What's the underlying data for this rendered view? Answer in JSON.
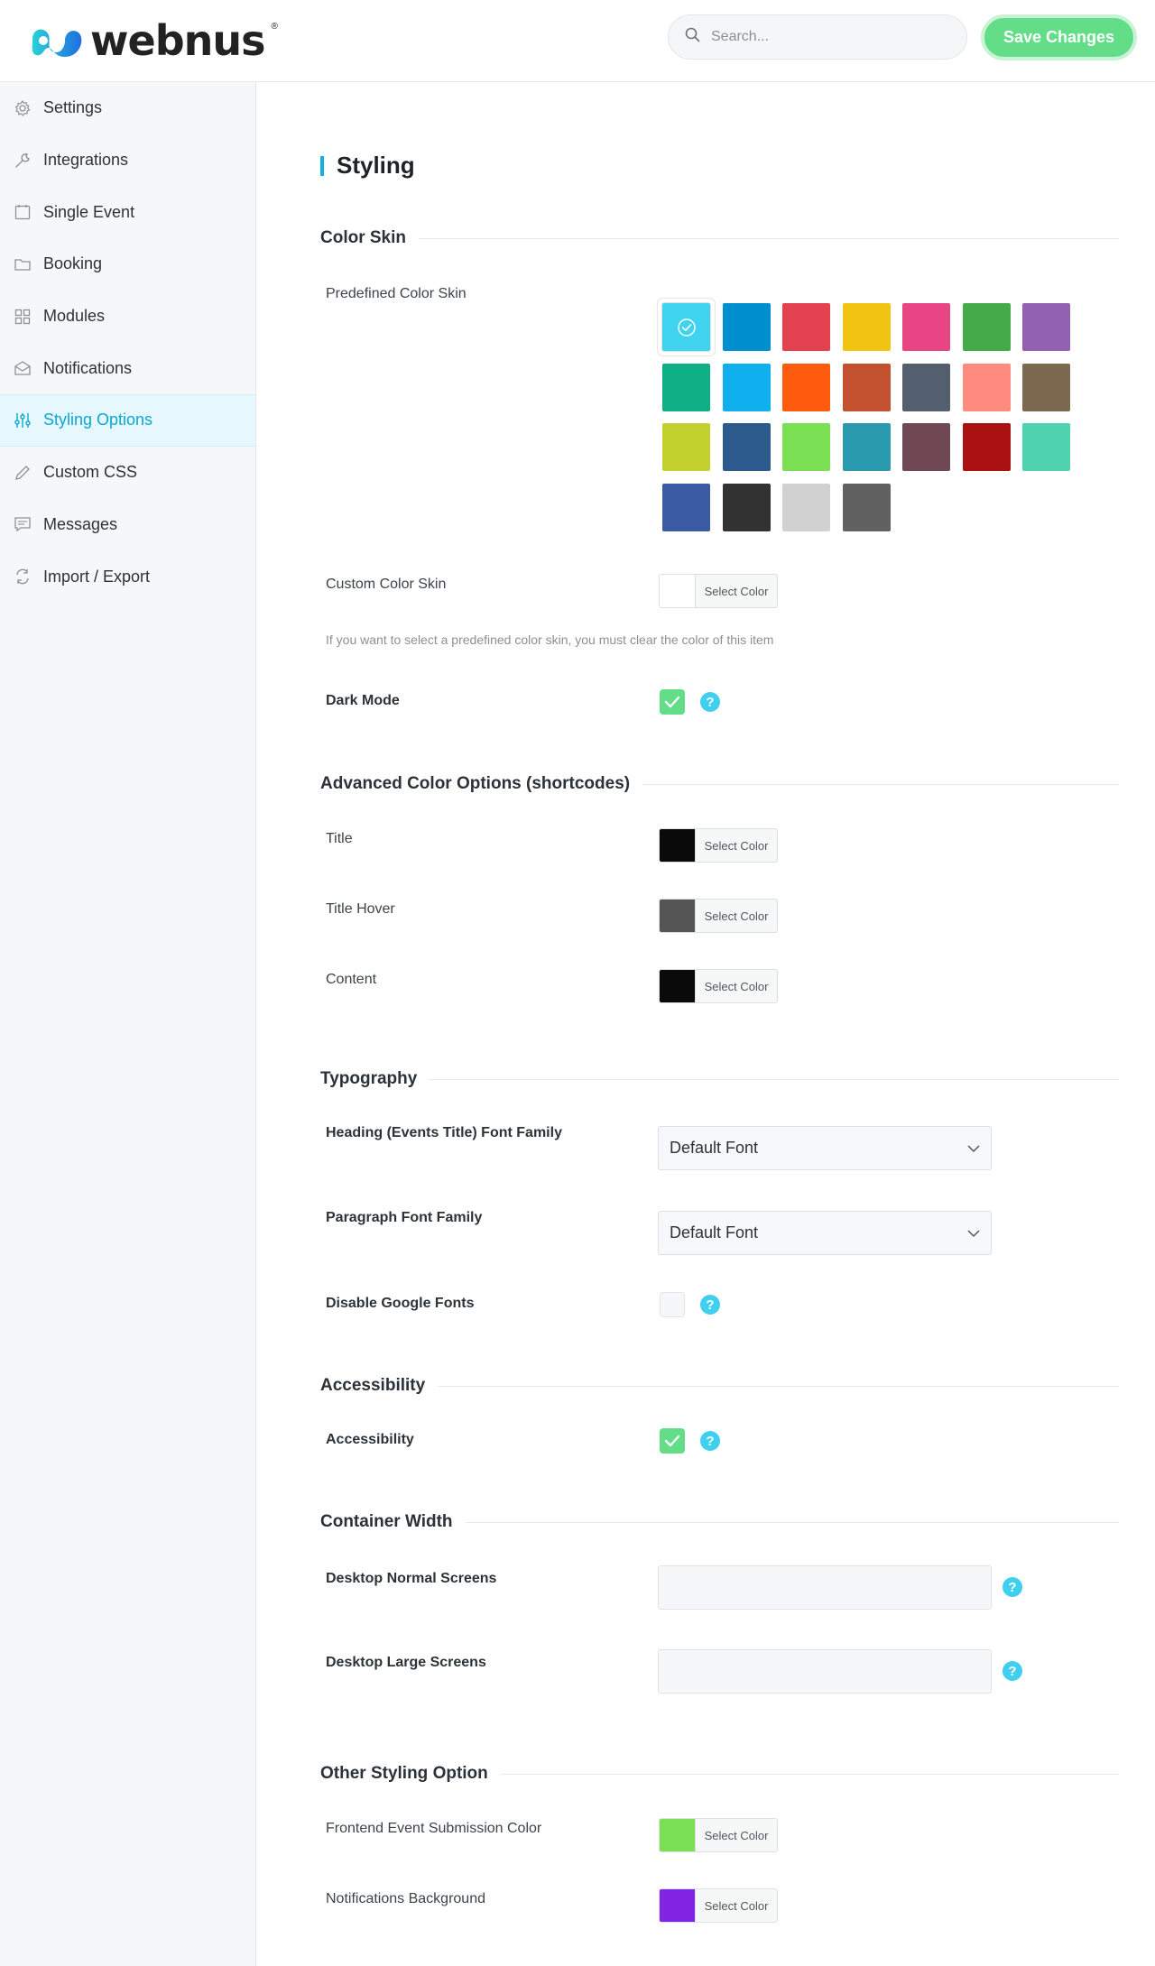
{
  "header": {
    "logo_text": "webnus",
    "logo_reg": "®",
    "search_placeholder": "Search...",
    "save_label": "Save Changes"
  },
  "sidebar": {
    "items": [
      {
        "label": "Settings",
        "icon": "gear-icon"
      },
      {
        "label": "Integrations",
        "icon": "wrench-icon"
      },
      {
        "label": "Single Event",
        "icon": "calendar-icon"
      },
      {
        "label": "Booking",
        "icon": "folder-icon"
      },
      {
        "label": "Modules",
        "icon": "grid-icon"
      },
      {
        "label": "Notifications",
        "icon": "envelope-icon"
      },
      {
        "label": "Styling Options",
        "icon": "sliders-icon",
        "active": true
      },
      {
        "label": "Custom CSS",
        "icon": "pencil-icon"
      },
      {
        "label": "Messages",
        "icon": "chat-icon"
      },
      {
        "label": "Import / Export",
        "icon": "sync-icon"
      }
    ]
  },
  "page": {
    "title": "Styling"
  },
  "color_skin": {
    "heading": "Color Skin",
    "predefined_label": "Predefined Color Skin",
    "swatches": [
      "#40d3ef",
      "#0090d0",
      "#e34050",
      "#f1c414",
      "#e84585",
      "#43ac48",
      "#9361b2",
      "#0eaf84",
      "#10b0ef",
      "#ff5b0f",
      "#c3502f",
      "#535f6f",
      "#ff8a7e",
      "#7c6950",
      "#c2d12e",
      "#2c5a8c",
      "#7bdf54",
      "#2a9aae",
      "#704854",
      "#aa1212",
      "#4fd2b0",
      "#3a5ba3",
      "#323232",
      "#d1d1d1",
      "#616161"
    ],
    "selected_index": 0,
    "custom_label": "Custom Color Skin",
    "custom_btn": "Select Color",
    "custom_color": "#ffffff",
    "hint": "If you want to select a predefined color skin, you must clear the color of this item",
    "dark_mode_label": "Dark Mode",
    "dark_mode_checked": true
  },
  "advanced": {
    "heading": "Advanced Color Options (shortcodes)",
    "rows": [
      {
        "label": "Title",
        "color": "#0a0a0a",
        "btn": "Select Color"
      },
      {
        "label": "Title Hover",
        "color": "#555555",
        "btn": "Select Color"
      },
      {
        "label": "Content",
        "color": "#0a0a0a",
        "btn": "Select Color"
      }
    ]
  },
  "typography": {
    "heading": "Typography",
    "heading_font_label": "Heading (Events Title) Font Family",
    "heading_font_value": "Default Font",
    "paragraph_font_label": "Paragraph Font Family",
    "paragraph_font_value": "Default Font",
    "disable_google_label": "Disable Google Fonts",
    "disable_google_checked": false
  },
  "accessibility": {
    "heading": "Accessibility",
    "label": "Accessibility",
    "checked": true
  },
  "container": {
    "heading": "Container Width",
    "normal_label": "Desktop Normal Screens",
    "large_label": "Desktop Large Screens"
  },
  "other": {
    "heading": "Other Styling Option",
    "rows": [
      {
        "label": "Frontend Event Submission Color",
        "color": "#7bdf54",
        "btn": "Select Color"
      },
      {
        "label": "Notifications Background",
        "color": "#8224e3",
        "btn": "Select Color"
      }
    ]
  },
  "help_glyph": "?"
}
